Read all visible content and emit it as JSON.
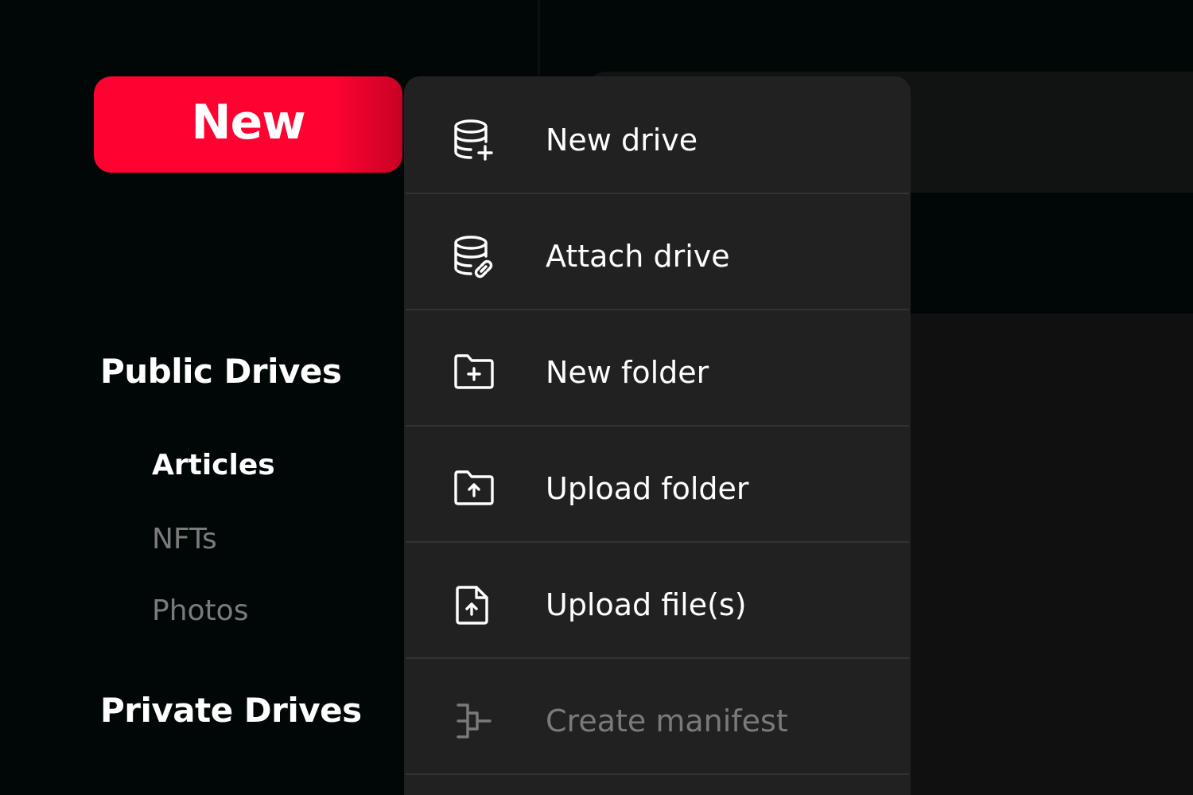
{
  "new_button": {
    "label": "New"
  },
  "sidebar": {
    "public_heading": "Public Drives",
    "public_items": [
      {
        "label": "Articles",
        "active": true
      },
      {
        "label": "NFTs",
        "active": false
      },
      {
        "label": "Photos",
        "active": false
      }
    ],
    "private_heading": "Private Drives"
  },
  "menu": {
    "items": [
      {
        "label": "New drive",
        "icon": "database-plus-icon",
        "enabled": true
      },
      {
        "label": "Attach drive",
        "icon": "database-link-icon",
        "enabled": true
      },
      {
        "label": "New folder",
        "icon": "folder-plus-icon",
        "enabled": true
      },
      {
        "label": "Upload folder",
        "icon": "folder-upload-icon",
        "enabled": true
      },
      {
        "label": "Upload file(s)",
        "icon": "file-upload-icon",
        "enabled": true
      },
      {
        "label": "Create manifest",
        "icon": "manifest-icon",
        "enabled": false
      }
    ]
  },
  "colors": {
    "background": "#000706",
    "accent": "#fe0232",
    "menu_background": "#212121",
    "menu_divider": "#333333",
    "text_primary": "#ffffff",
    "text_muted": "#7b7b7b"
  }
}
